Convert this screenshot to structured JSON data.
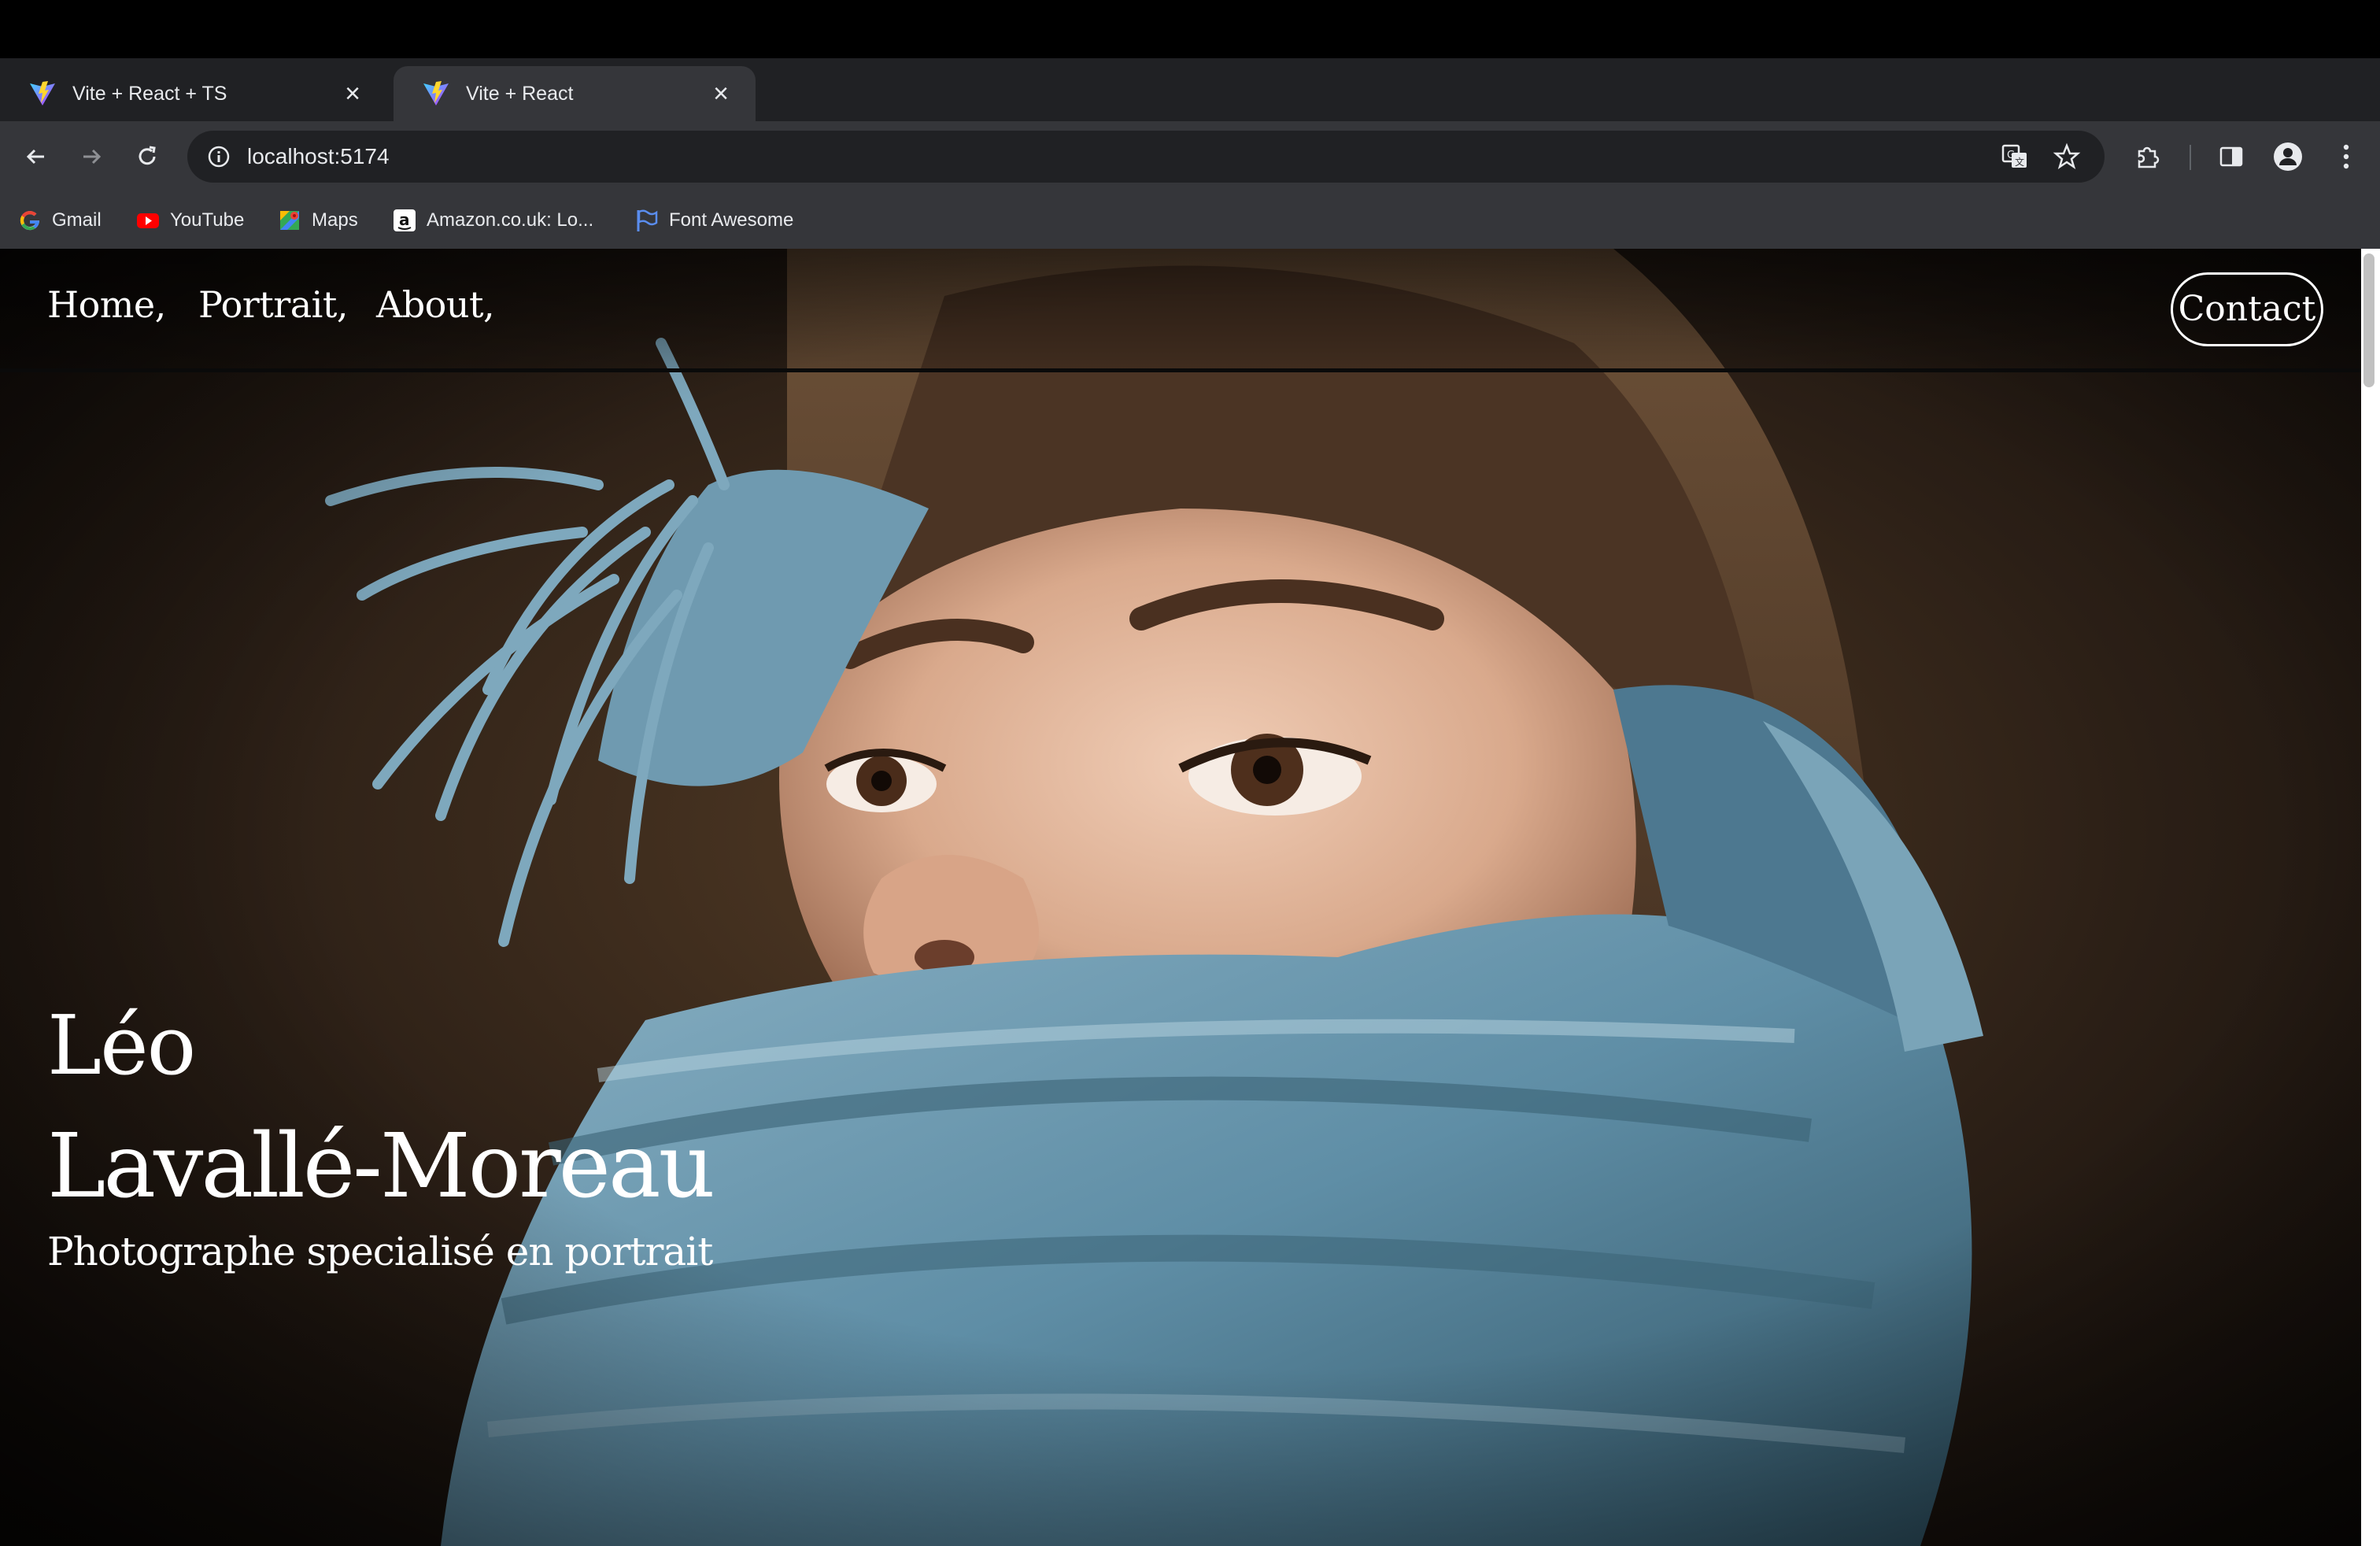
{
  "browser": {
    "tabs": [
      {
        "title": "Vite + React + TS",
        "active": false
      },
      {
        "title": "Vite + React",
        "active": true
      }
    ],
    "new_tab_label": "+",
    "close_glyph": "×",
    "address": "localhost:5174",
    "bookmarks": [
      {
        "label": "Gmail",
        "icon": "google-icon"
      },
      {
        "label": "YouTube",
        "icon": "youtube-icon"
      },
      {
        "label": "Maps",
        "icon": "maps-icon"
      },
      {
        "label": "Amazon.co.uk: Lo...",
        "icon": "amazon-icon"
      },
      {
        "label": "Font Awesome",
        "icon": "font-awesome-flag-icon"
      }
    ],
    "colors": {
      "chrome_dark": "#202124",
      "chrome_mid": "#35363a",
      "text": "#e8eaed"
    }
  },
  "site": {
    "nav": [
      {
        "label": "Home,"
      },
      {
        "label": "Portrait,"
      },
      {
        "label": "About,"
      }
    ],
    "contact_label": "Contact",
    "hero": {
      "first_name": "Léo",
      "last_name": "Lavallé-Moreau",
      "tagline": "Photographe specialisé en portrait"
    }
  }
}
